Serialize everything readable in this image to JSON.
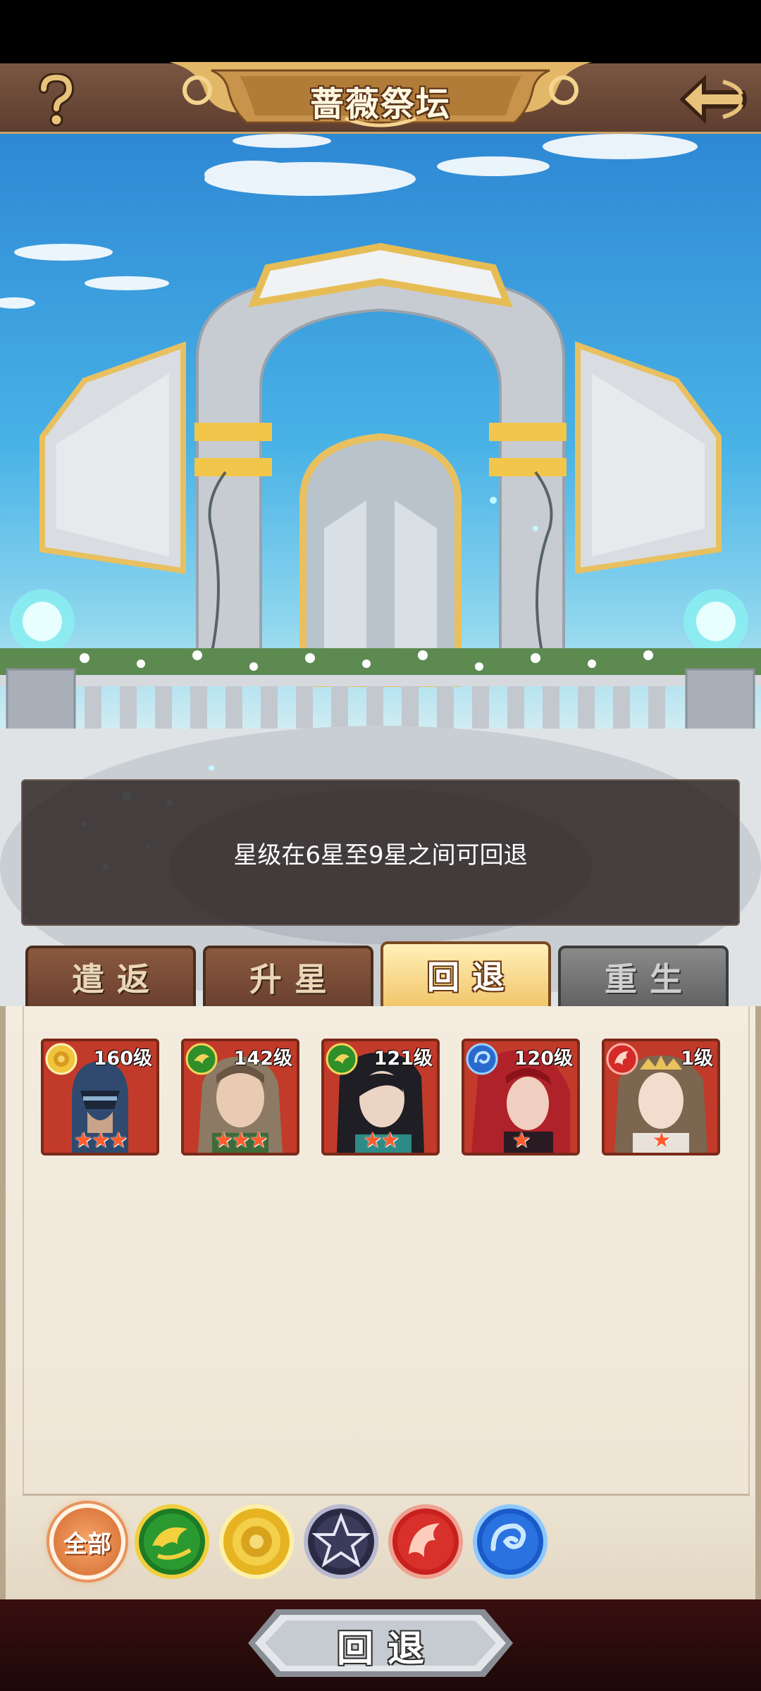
{
  "header": {
    "title": "蔷薇祭坛",
    "help_icon": "question-mark-icon",
    "back_icon": "back-arrow-icon"
  },
  "info": {
    "message": "星级在6星至9星之间可回退"
  },
  "tabs": [
    {
      "label": "遣返",
      "state": "normal"
    },
    {
      "label": "升星",
      "state": "normal"
    },
    {
      "label": "回退",
      "state": "active"
    },
    {
      "label": "重生",
      "state": "disabled"
    }
  ],
  "heroes": [
    {
      "level": "160级",
      "faction": "rose",
      "stars": 3,
      "color": "#2f4a6e"
    },
    {
      "level": "142级",
      "faction": "dragon",
      "stars": 3,
      "color": "#8c7a64"
    },
    {
      "level": "121级",
      "faction": "dragon",
      "stars": 2,
      "color": "#2a2a30"
    },
    {
      "level": "120级",
      "faction": "water",
      "stars": 1,
      "color": "#b0222a"
    },
    {
      "level": "1级",
      "faction": "phoenix",
      "stars": 1,
      "color": "#7c6650"
    }
  ],
  "filters": {
    "all_label": "全部",
    "icons": [
      "dragon-faction-icon",
      "rose-faction-icon",
      "star-faction-icon",
      "phoenix-faction-icon",
      "water-faction-icon"
    ]
  },
  "action": {
    "confirm_label": "回退"
  },
  "colors": {
    "header_brown": "#6a4634",
    "gold": "#e8c27a",
    "panel_parchment": "#f1e9db",
    "tab_active": "#f2c66c",
    "card_red": "#c23a2a",
    "star": "#ff5a2a"
  }
}
